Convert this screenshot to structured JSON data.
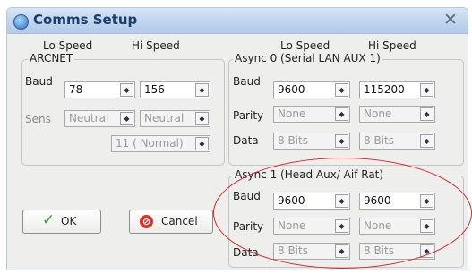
{
  "window": {
    "title": "Comms Setup",
    "app_icon": "comms-icon",
    "close_glyph": "✕"
  },
  "headers": {
    "lo_speed_left": "Lo Speed",
    "hi_speed_left": "Hi Speed",
    "lo_speed_right": "Lo Speed",
    "hi_speed_right": "Hi Speed"
  },
  "arcnet": {
    "legend": "ARCNET",
    "baud_label": "Baud",
    "baud_lo": "78",
    "baud_hi": "156",
    "sens_label": "Sens",
    "sens_lo": "Neutral",
    "sens_hi": "Neutral",
    "mode": "11 ( Normal)"
  },
  "async0": {
    "legend": "Async 0 (Serial LAN AUX 1)",
    "baud_label": "Baud",
    "baud_lo": "9600",
    "baud_hi": "115200",
    "parity_label": "Parity",
    "parity_lo": "None",
    "parity_hi": "None",
    "data_label": "Data",
    "data_lo": "8 Bits",
    "data_hi": "8 Bits"
  },
  "async1": {
    "legend": "Async 1 (Head Aux/ Aif Rat)",
    "baud_label": "Baud",
    "baud_lo": "9600",
    "baud_hi": "9600",
    "parity_label": "Parity",
    "parity_lo": "None",
    "parity_hi": "None",
    "data_label": "Data",
    "data_lo": "8 Bits",
    "data_hi": "8 Bits"
  },
  "buttons": {
    "ok_label": "OK",
    "cancel_label": "Cancel",
    "ok_icon": "check-icon",
    "cancel_icon": "cancel-icon"
  },
  "combo_arrow": "◆",
  "annotation_color": "#d42424"
}
